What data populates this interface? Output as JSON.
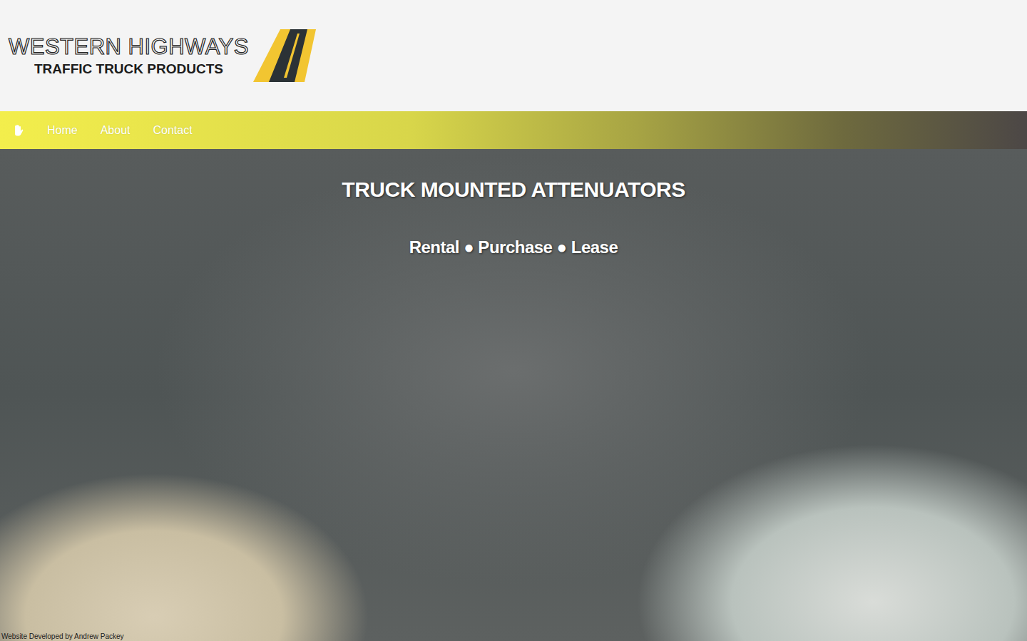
{
  "logo": {
    "title": "WESTERN HIGHWAYS",
    "subtitle": "TRAFFIC TRUCK PRODUCTS"
  },
  "nav": {
    "items": [
      {
        "label": "Home"
      },
      {
        "label": "About"
      },
      {
        "label": "Contact"
      }
    ]
  },
  "hero": {
    "title": "TRUCK MOUNTED ATTENUATORS",
    "subtitle": "Rental ● Purchase ● Lease"
  },
  "footer": {
    "credit": "Website Developed by Andrew Packey"
  }
}
